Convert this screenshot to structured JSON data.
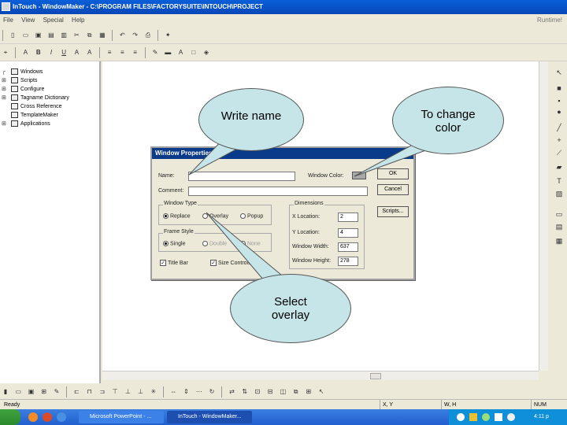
{
  "window": {
    "title": "InTouch - WindowMaker - C:\\PROGRAM FILES\\FACTORYSUITE\\INTOUCH\\PROJECT",
    "runtime_label": "Runtime!"
  },
  "menu": [
    "File",
    "View",
    "Special",
    "Help"
  ],
  "explorer": {
    "items": [
      "Windows",
      "Scripts",
      "Configure",
      "Tagname Dictionary",
      "Cross Reference",
      "TemplateMaker",
      "Applications"
    ]
  },
  "dialog": {
    "title": "Window Properties",
    "name_label": "Name:",
    "name_value": "",
    "comment_label": "Comment:",
    "comment_value": "",
    "window_color_label": "Window Color:",
    "window_color": "#a8a8a8",
    "ok_label": "OK",
    "cancel_label": "Cancel",
    "scripts_label": "Scripts...",
    "window_type_label": "Window Type",
    "window_type_options": [
      "Replace",
      "Overlay",
      "Popup"
    ],
    "frame_style_label": "Frame Style",
    "frame_style_options": [
      "Single",
      "Double",
      "None"
    ],
    "dimensions_label": "Dimensions",
    "x_location_label": "X Location:",
    "x_location_value": "2",
    "y_location_label": "Y Location:",
    "y_location_value": "4",
    "width_label": "Window Width:",
    "width_value": "637",
    "height_label": "Window Height:",
    "height_value": "278",
    "title_bar_label": "Title Bar",
    "size_controls_label": "Size Controls"
  },
  "callouts": {
    "write_name": "Write name",
    "change_color": "To change color",
    "select_overlay": "Select overlay"
  },
  "status": {
    "left": "Ready",
    "xy": "X, Y",
    "wh": "W, H",
    "num": "NUM"
  },
  "taskbar": {
    "tasks": [
      "Microsoft PowerPoint - ...",
      "InTouch - WindowMaker..."
    ],
    "clock": "4:11 p"
  },
  "colors": {
    "callout_fill": "#c6e5e9",
    "titlebar": "#0747b8"
  }
}
